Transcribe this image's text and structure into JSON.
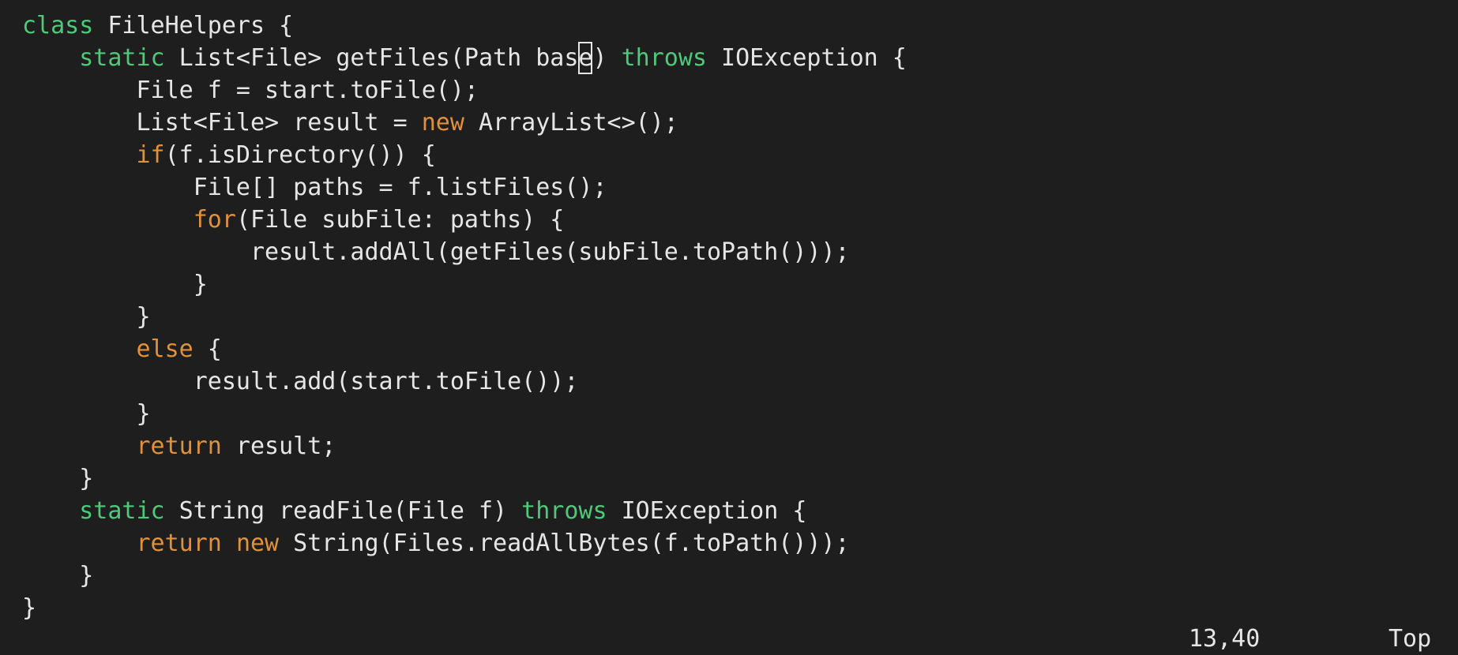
{
  "editor": {
    "lines": [
      [
        {
          "t": "class",
          "c": "kw-green"
        },
        {
          "t": " FileHelpers {",
          "c": "text"
        }
      ],
      [
        {
          "t": "    ",
          "c": "text"
        },
        {
          "t": "static",
          "c": "kw-green"
        },
        {
          "t": " List<File> getFiles(Path bas",
          "c": "text"
        },
        {
          "t": "e",
          "c": "cursor"
        },
        {
          "t": ") ",
          "c": "text"
        },
        {
          "t": "throws",
          "c": "kw-green"
        },
        {
          "t": " IOException {",
          "c": "text"
        }
      ],
      [
        {
          "t": "        File f = start.toFile();",
          "c": "text"
        }
      ],
      [
        {
          "t": "        List<File> result = ",
          "c": "text"
        },
        {
          "t": "new",
          "c": "kw-orange"
        },
        {
          "t": " ArrayList<>();",
          "c": "text"
        }
      ],
      [
        {
          "t": "        ",
          "c": "text"
        },
        {
          "t": "if",
          "c": "kw-orange"
        },
        {
          "t": "(f.isDirectory()) {",
          "c": "text"
        }
      ],
      [
        {
          "t": "            File[] paths = f.listFiles();",
          "c": "text"
        }
      ],
      [
        {
          "t": "            ",
          "c": "text"
        },
        {
          "t": "for",
          "c": "kw-orange"
        },
        {
          "t": "(File subFile: paths) {",
          "c": "text"
        }
      ],
      [
        {
          "t": "                result.addAll(getFiles(subFile.toPath()));",
          "c": "text"
        }
      ],
      [
        {
          "t": "            }",
          "c": "text"
        }
      ],
      [
        {
          "t": "        }",
          "c": "text"
        }
      ],
      [
        {
          "t": "        ",
          "c": "text"
        },
        {
          "t": "else",
          "c": "kw-orange"
        },
        {
          "t": " {",
          "c": "text"
        }
      ],
      [
        {
          "t": "            result.add(start.toFile());",
          "c": "text"
        }
      ],
      [
        {
          "t": "        }",
          "c": "text"
        }
      ],
      [
        {
          "t": "        ",
          "c": "text"
        },
        {
          "t": "return",
          "c": "kw-orange"
        },
        {
          "t": " result;",
          "c": "text"
        }
      ],
      [
        {
          "t": "    }",
          "c": "text"
        }
      ],
      [
        {
          "t": "    ",
          "c": "text"
        },
        {
          "t": "static",
          "c": "kw-green"
        },
        {
          "t": " String readFile(File f) ",
          "c": "text"
        },
        {
          "t": "throws",
          "c": "kw-green"
        },
        {
          "t": " IOException {",
          "c": "text"
        }
      ],
      [
        {
          "t": "        ",
          "c": "text"
        },
        {
          "t": "return",
          "c": "kw-orange"
        },
        {
          "t": " ",
          "c": "text"
        },
        {
          "t": "new",
          "c": "kw-orange"
        },
        {
          "t": " String(Files.readAllBytes(f.toPath()));",
          "c": "text"
        }
      ],
      [
        {
          "t": "    }",
          "c": "text"
        }
      ],
      [
        {
          "t": "}",
          "c": "text"
        }
      ]
    ]
  },
  "status": {
    "position": "13,40",
    "scroll": "Top"
  },
  "colors": {
    "background": "#1e1e1e",
    "text": "#e6e6e6",
    "keyword_green": "#4ec97a",
    "keyword_orange": "#e0913a"
  }
}
